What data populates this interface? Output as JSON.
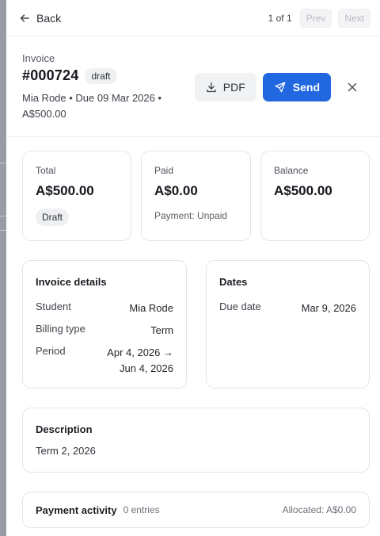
{
  "nav": {
    "back_label": "Back",
    "pager_count": "1 of 1",
    "prev_label": "Prev",
    "next_label": "Next"
  },
  "invoice": {
    "kicker": "Invoice",
    "number": "#000724",
    "status_badge": "draft",
    "meta": "Mia Rode • Due 09 Mar 2026 • A$500.00",
    "pdf_label": "PDF",
    "send_label": "Send"
  },
  "summary": {
    "total_label": "Total",
    "total_value": "A$500.00",
    "total_status": "Draft",
    "paid_label": "Paid",
    "paid_value": "A$0.00",
    "paid_sub": "Payment: Unpaid",
    "balance_label": "Balance",
    "balance_value": "A$500.00"
  },
  "details": {
    "heading": "Invoice details",
    "rows": [
      {
        "key": "Student",
        "value": "Mia Rode"
      },
      {
        "key": "Billing type",
        "value": "Term"
      },
      {
        "key": "Period",
        "value": "Apr 4, 2026 → Jun 4, 2026"
      }
    ]
  },
  "dates": {
    "heading": "Dates",
    "rows": [
      {
        "key": "Due date",
        "value": "Mar 9, 2026"
      }
    ]
  },
  "description": {
    "heading": "Description",
    "text": "Term 2, 2026"
  },
  "payments": {
    "heading": "Payment activity",
    "entries": "0 entries",
    "allocated": "Allocated: A$0.00"
  },
  "colors": {
    "accent": "#2167e0",
    "border": "#e4e5e9"
  },
  "icons": [
    "arrow-left-icon",
    "download-icon",
    "send-icon",
    "close-icon"
  ]
}
